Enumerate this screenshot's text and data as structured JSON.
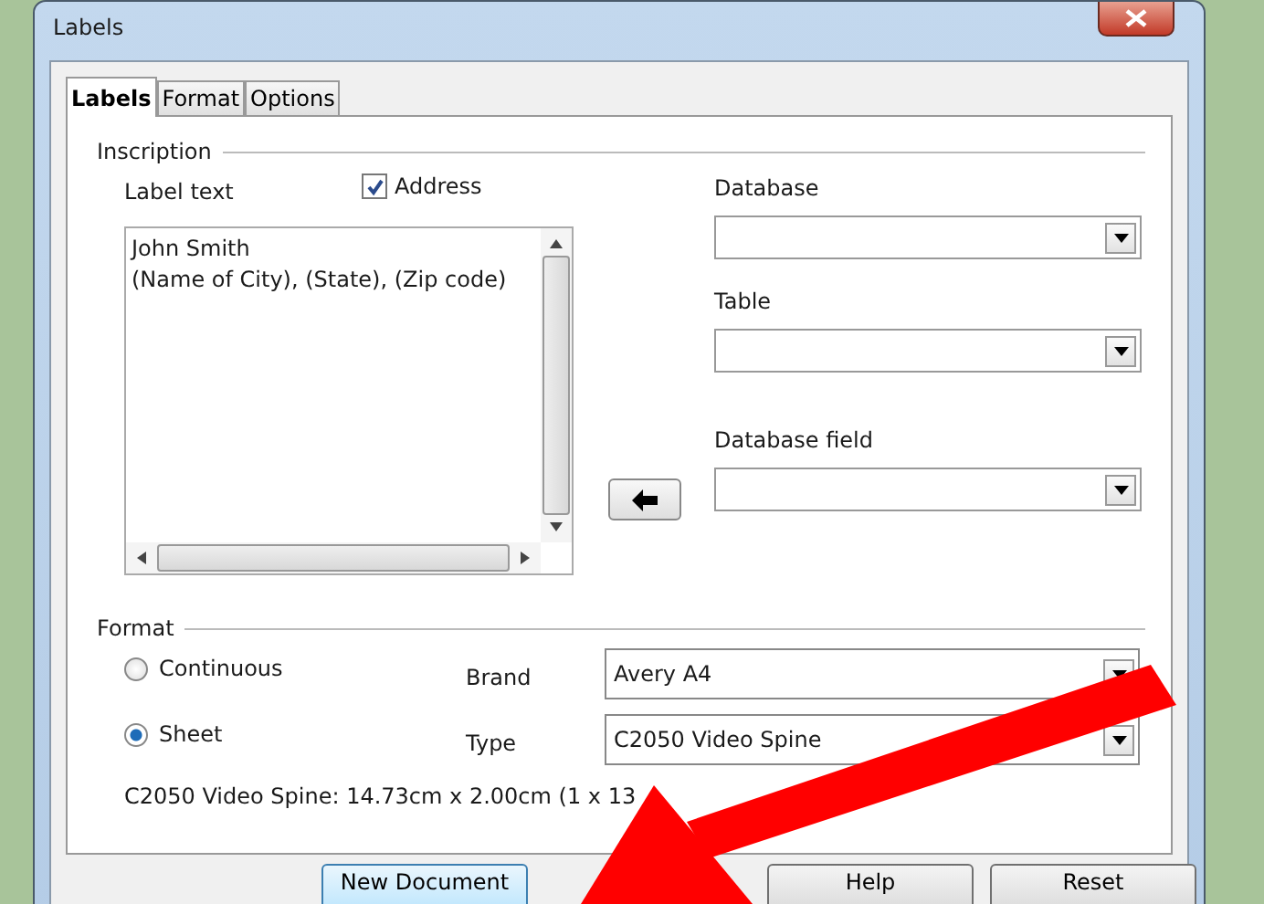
{
  "window": {
    "title": "Labels"
  },
  "tabs": [
    {
      "label": "Labels",
      "selected": true
    },
    {
      "label": "Format",
      "selected": false
    },
    {
      "label": "Options",
      "selected": false
    }
  ],
  "inscription": {
    "title": "Inscription",
    "label_text_label": "Label text",
    "address": {
      "label": "Address",
      "checked": true
    },
    "label_text": [
      "John Smith",
      "(Name of City), (State), (Zip code)"
    ]
  },
  "database": {
    "label": "Database"
  },
  "table": {
    "label": "Table"
  },
  "database_field": {
    "label": "Database field"
  },
  "format": {
    "title": "Format",
    "options": [
      {
        "label": "Continuous",
        "selected": false
      },
      {
        "label": "Sheet",
        "selected": true
      }
    ],
    "brand": {
      "label": "Brand",
      "value": "Avery A4"
    },
    "type": {
      "label": "Type",
      "value": "C2050 Video Spine"
    },
    "info": "C2050 Video Spine: 14.73cm x 2.00cm (1 x 13"
  },
  "buttons": [
    "New Document",
    "Help",
    "Reset"
  ]
}
